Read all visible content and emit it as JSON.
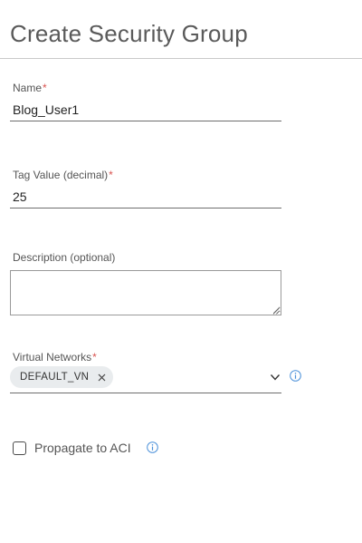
{
  "dialog": {
    "title": "Create Security Group"
  },
  "form": {
    "name": {
      "label": "Name",
      "required_marker": "*",
      "value": "Blog_User1"
    },
    "tag_value": {
      "label": "Tag Value (decimal)",
      "required_marker": "*",
      "value": "25"
    },
    "description": {
      "label": "Description (optional)",
      "value": ""
    },
    "virtual_networks": {
      "label": "Virtual Networks",
      "required_marker": "*",
      "selected": [
        "DEFAULT_VN"
      ],
      "remove_icon": "close-icon",
      "dropdown_icon": "chevron-down-icon",
      "info_icon": "info-icon"
    },
    "propagate_to_aci": {
      "label": "Propagate to ACI",
      "checked": false,
      "info_icon": "info-icon"
    }
  },
  "colors": {
    "required": "#d9534f",
    "info": "#4a90d9",
    "divider": "#c9c9c9"
  }
}
